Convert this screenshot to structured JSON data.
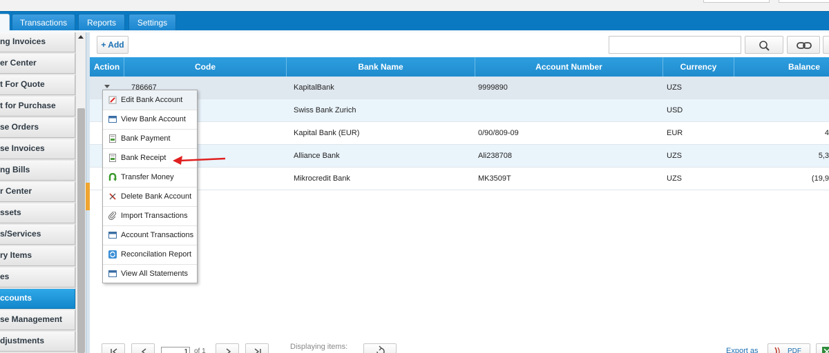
{
  "tabs": [
    {
      "label": ""
    },
    {
      "label": "Transactions"
    },
    {
      "label": "Reports"
    },
    {
      "label": "Settings"
    }
  ],
  "sidebar": {
    "items": [
      {
        "label": "ng Invoices"
      },
      {
        "label": "er Center"
      },
      {
        "label": "t For Quote"
      },
      {
        "label": "t for Purchase"
      },
      {
        "label": "se Orders"
      },
      {
        "label": "se Invoices"
      },
      {
        "label": "ng Bills"
      },
      {
        "label": "r Center"
      },
      {
        "label": "ssets"
      },
      {
        "label": "s/Services"
      },
      {
        "label": "ry Items"
      },
      {
        "label": "es"
      },
      {
        "label": "ccounts"
      },
      {
        "label": "se Management"
      },
      {
        "label": "djustments"
      }
    ],
    "active_index": 12
  },
  "toolbar": {
    "add_label": "+ Add",
    "search_placeholder": ""
  },
  "grid": {
    "columns": [
      "Action",
      "Code",
      "Bank Name",
      "Account Number",
      "Currency",
      "Balance"
    ],
    "rows": [
      {
        "code": "786667",
        "bank_name": "KapitalBank",
        "account_number": "9999890",
        "currency": "UZS",
        "balance": ""
      },
      {
        "code": "",
        "bank_name": "Swiss Bank Zurich",
        "account_number": "",
        "currency": "USD",
        "balance": ""
      },
      {
        "code": "",
        "bank_name": "Kapital Bank (EUR)",
        "account_number": "0/90/809-09",
        "currency": "EUR",
        "balance": "4"
      },
      {
        "code": "",
        "bank_name": "Alliance Bank",
        "account_number": "Ali238708",
        "currency": "UZS",
        "balance": "5,3"
      },
      {
        "code": "",
        "bank_name": "Mikrocredit Bank",
        "account_number": "MK3509T",
        "currency": "UZS",
        "balance": "(19,9"
      }
    ]
  },
  "action_menu": {
    "items": [
      {
        "label": "Edit Bank Account",
        "icon": "edit-icon"
      },
      {
        "label": "View Bank Account",
        "icon": "window-icon"
      },
      {
        "label": "Bank Payment",
        "icon": "document-icon"
      },
      {
        "label": "Bank Receipt",
        "icon": "document-icon"
      },
      {
        "label": "Transfer Money",
        "icon": "transfer-icon"
      },
      {
        "label": "Delete Bank Account",
        "icon": "delete-icon"
      },
      {
        "label": "Import Transactions",
        "icon": "paperclip-icon"
      },
      {
        "label": "Account Transactions",
        "icon": "window-icon"
      },
      {
        "label": "Reconcilation Report",
        "icon": "refresh-icon"
      },
      {
        "label": "View All Statements",
        "icon": "window-icon"
      }
    ]
  },
  "pager": {
    "page_value": "1",
    "of_label": "of 1",
    "displaying_label": "Displaying items:",
    "export_label": "Export as",
    "pdf_label": "PDF"
  },
  "colors": {
    "accent": "#0a79c2",
    "header": "#2e9fe0",
    "annotation_arrow": "#e02020"
  }
}
